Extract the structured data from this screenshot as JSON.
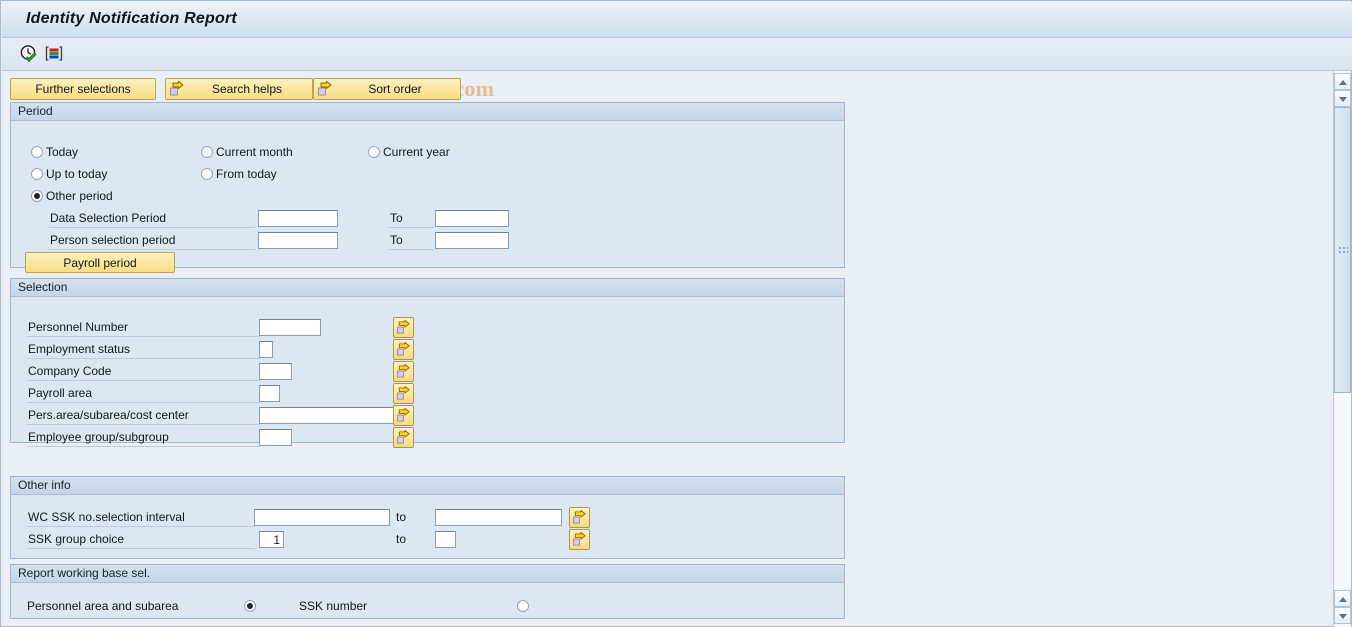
{
  "window": {
    "title": "Identity Notification Report",
    "watermark": "© www.tutorialkart.com"
  },
  "toolbar": {
    "execute_icon": "clock-check-execute-icon",
    "multiple_selection_icon": "colored-bars-icon"
  },
  "action_buttons": [
    {
      "label": "Further selections",
      "icon": null,
      "name": "further-selections-button"
    },
    {
      "label": "Search helps",
      "icon": "yellow-arrow-icon",
      "name": "search-helps-button"
    },
    {
      "label": "Sort order",
      "icon": "yellow-arrow-icon",
      "name": "sort-order-button"
    }
  ],
  "period": {
    "title": "Period",
    "radios": [
      {
        "label": "Today",
        "selected": false,
        "name": "radio-today"
      },
      {
        "label": "Current month",
        "selected": false,
        "name": "radio-current-month"
      },
      {
        "label": "Current year",
        "selected": false,
        "name": "radio-current-year"
      },
      {
        "label": "Up to today",
        "selected": false,
        "name": "radio-up-to-today"
      },
      {
        "label": "From today",
        "selected": false,
        "name": "radio-from-today"
      },
      {
        "label": "Other period",
        "selected": true,
        "name": "radio-other-period"
      }
    ],
    "rows": [
      {
        "label": "Data Selection Period",
        "from_value": "",
        "to_label": "To",
        "to_value": ""
      },
      {
        "label": "Person selection period",
        "from_value": "",
        "to_label": "To",
        "to_value": ""
      }
    ],
    "payroll_period_button": "Payroll period"
  },
  "selection": {
    "title": "Selection",
    "rows": [
      {
        "label": "Personnel Number",
        "value": "",
        "field_width": 62,
        "name": "personnel-number"
      },
      {
        "label": "Employment status",
        "value": "",
        "field_width": 13,
        "name": "employment-status"
      },
      {
        "label": "Company Code",
        "value": "",
        "field_width": 32,
        "name": "company-code"
      },
      {
        "label": "Payroll area",
        "value": "",
        "field_width": 21,
        "name": "payroll-area"
      },
      {
        "label": "Pers.area/subarea/cost center",
        "value": "",
        "field_width": 138,
        "name": "pers-area-subarea-cost-center"
      },
      {
        "label": "Employee group/subgroup",
        "value": "",
        "field_width": 32,
        "name": "employee-group-subgroup"
      }
    ],
    "multi_select_icon": "yellow-arrow-multiple-selection-icon"
  },
  "other_info": {
    "title": "Other info",
    "rows": [
      {
        "label": "WC SSK no.selection interval",
        "from_value": "",
        "to_label": "to",
        "to_value": "",
        "from_width": 136,
        "to_width": 132,
        "name": "wc-ssk-no-selection-interval"
      },
      {
        "label": "SSK group choice",
        "from_value": "1",
        "to_label": "to",
        "to_value": "",
        "from_width": 25,
        "to_width": 21,
        "name": "ssk-group-choice"
      }
    ]
  },
  "report_base": {
    "title": "Report working base sel.",
    "options": [
      {
        "label": "Personnel area and subarea",
        "selected": true,
        "name": "radio-personnel-area-and-subarea"
      },
      {
        "label": "SSK number",
        "selected": false,
        "name": "radio-ssk-number"
      }
    ]
  },
  "scrollbars": {
    "top_up_icon": "scroll-up-arrow-icon",
    "top_down_icon": "scroll-down-arrow-icon",
    "bottom_up_icon": "scroll-up-arrow-icon",
    "bottom_down_icon": "scroll-down-arrow-icon"
  },
  "colors": {
    "accent_button": "#fae79e",
    "panel_bg": "#dde7f1",
    "page_bg": "#eaeff6",
    "watermark": "#eab98d"
  }
}
